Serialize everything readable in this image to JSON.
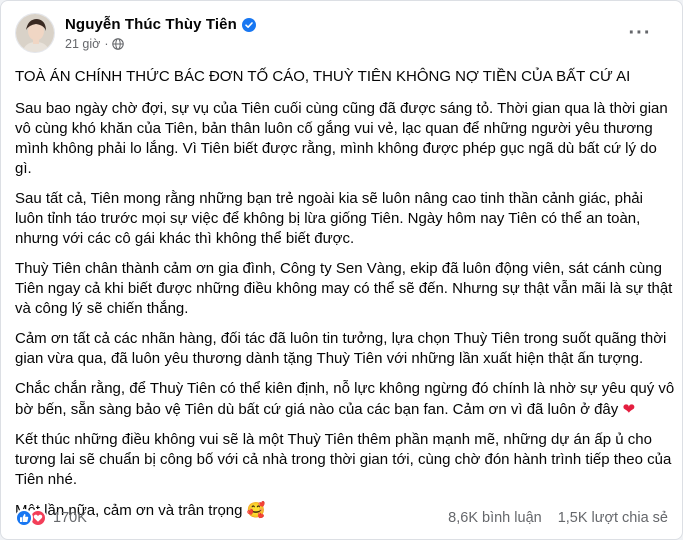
{
  "post": {
    "author": "Nguyễn Thúc Thùy Tiên",
    "time": "21 giờ",
    "dot": "·",
    "title": "TOÀ ÁN CHÍNH THỨC BÁC ĐƠN TỐ CÁO, THUỲ TIÊN KHÔNG NỢ TIỀN CỦA BẤT CỨ AI",
    "paragraphs": [
      "Sau bao ngày chờ đợi, sự vụ của Tiên cuối cùng cũng đã được sáng tỏ. Thời gian qua là thời gian vô cùng khó khăn của Tiên, bản thân luôn cố gắng vui vẻ, lạc quan để những người yêu thương mình không phải lo lắng. Vì Tiên biết được rằng, mình không được phép gục ngã dù bất cứ lý do gì.",
      "Sau tất cả, Tiên mong rằng những bạn trẻ ngoài kia sẽ luôn nâng cao tinh thần cảnh giác, phải luôn tỉnh táo trước mọi sự việc để không bị lừa giống Tiên. Ngày hôm nay Tiên có thể an toàn, nhưng với các cô gái khác thì không thể biết được.",
      "Thuỳ Tiên chân thành cảm ơn gia đình, Công ty Sen Vàng,  ekip đã luôn động viên, sát cánh cùng Tiên ngay cả khi biết được những điều không may có thể sẽ đến. Nhưng sự thật vẫn mãi là sự thật và công lý sẽ chiến thắng.",
      "Cảm ơn tất cả các nhãn hàng, đối tác đã luôn tin tưởng, lựa chọn Thuỳ Tiên trong suốt quãng thời gian vừa qua, đã luôn yêu thương dành tặng Thuỳ Tiên với những lần xuất hiện thật ấn tượng."
    ],
    "para5": "Chắc chắn rằng, để Thuỳ Tiên có thể kiên định, nỗ lực không ngừng đó chính là nhờ sự yêu quý vô bờ bến, sẵn sàng bảo vệ Tiên dù bất cứ giá nào của các bạn fan. Cảm ơn vì đã luôn ở đây",
    "para5_emoji": "❤",
    "para6": "Kết thúc những điều không vui sẽ là một Thuỳ Tiên thêm phần mạnh mẽ, những dự án ấp ủ cho tương lai sẽ chuẩn bị công bố với cả nhà trong thời gian tới, cùng chờ đón hành trình tiếp theo của Tiên nhé.",
    "para7": "Một lần nữa, cảm ơn và trân trọng",
    "para7_emoji": "🥰",
    "more_label": "···",
    "reactions_count": "170K",
    "comments": "8,6K bình luận",
    "shares": "1,5K lượt chia sẻ"
  },
  "colors": {
    "facebook_blue": "#1877f2",
    "love_red": "#f33e58",
    "secondary_text": "#65676b"
  },
  "icons": [
    "verified-badge-icon",
    "globe-icon",
    "more-options-icon",
    "like-reaction-icon",
    "love-reaction-icon"
  ]
}
